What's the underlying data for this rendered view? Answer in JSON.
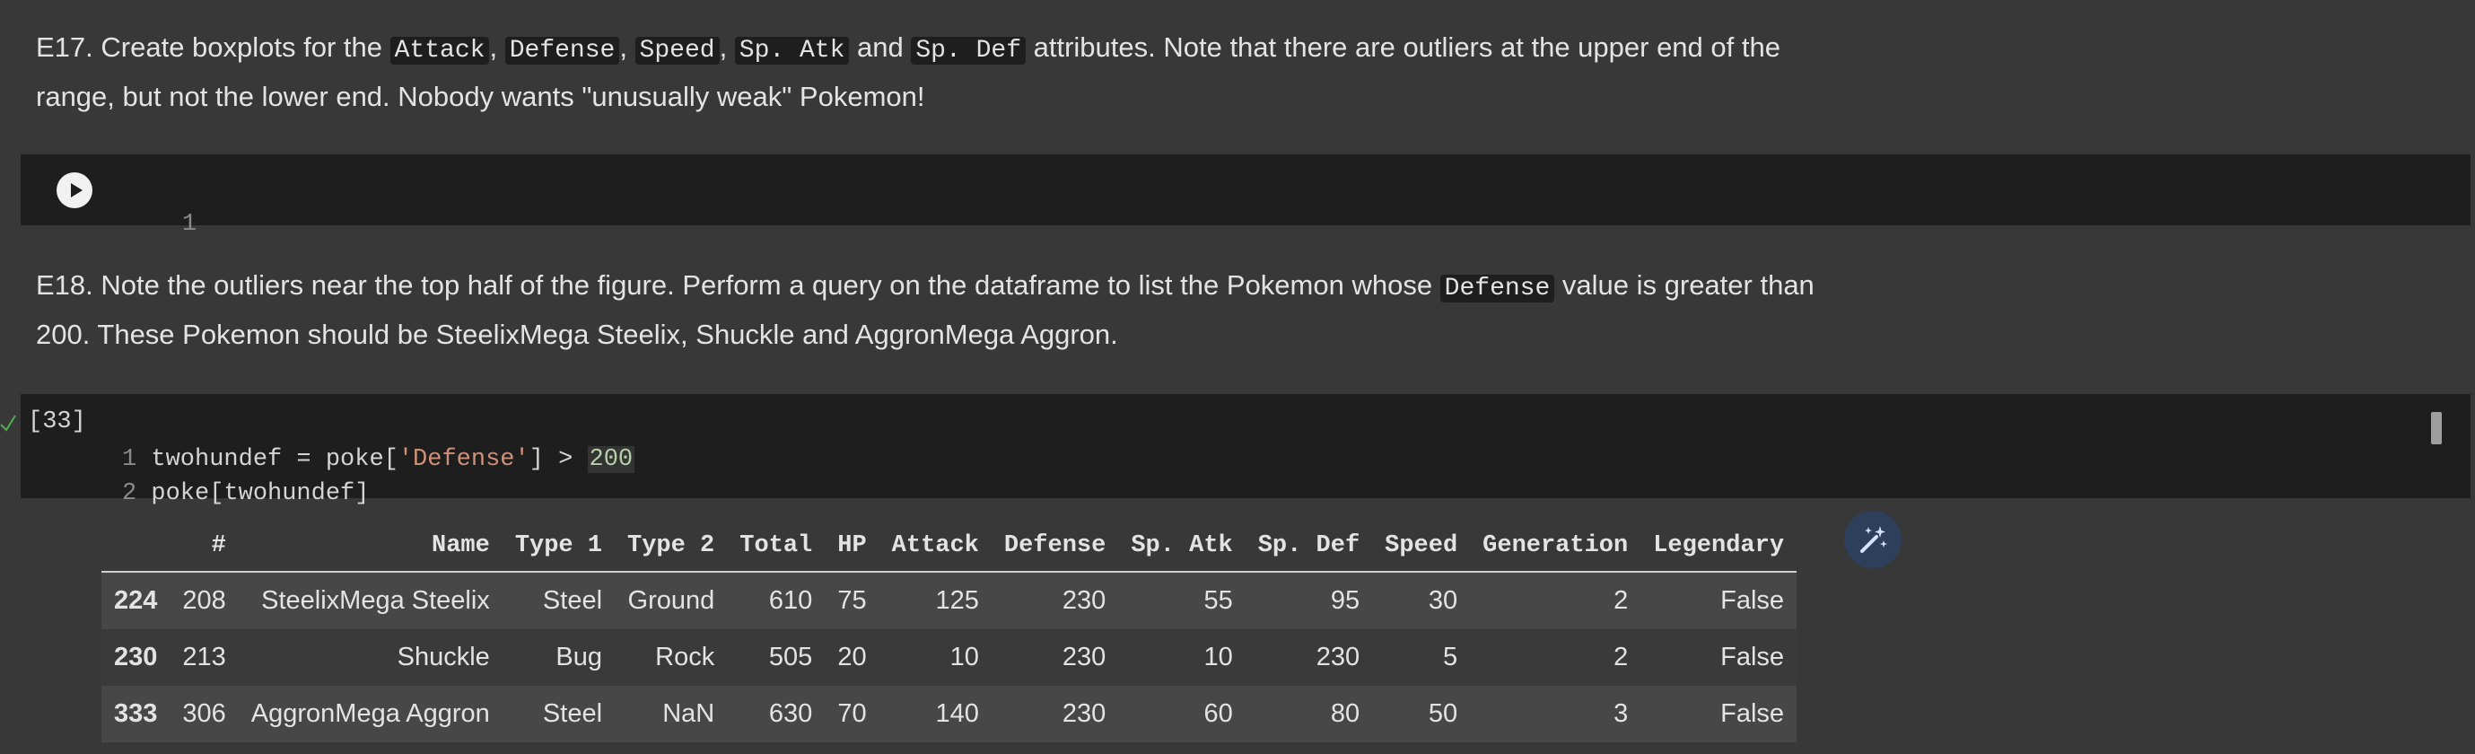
{
  "e17": {
    "prefix": "E17. Create boxplots for the ",
    "code1": "Attack",
    "sep1": ", ",
    "code2": "Defense",
    "sep2": ", ",
    "code3": "Speed",
    "sep3": ", ",
    "code4": "Sp. Atk",
    "sep4": " and ",
    "code5": "Sp. Def",
    "suffix": " attributes. Note that there are outliers at the upper end of the range, but not the lower end. Nobody wants \"unusually weak\" Pokemon!"
  },
  "empty_cell": {
    "line_number": "1"
  },
  "e18": {
    "prefix": "E18. Note the outliers near the top half of the figure. Perform a query on the dataframe to list the Pokemon whose ",
    "code1": "Defense",
    "suffix": " value is greater than 200. These Pokemon should be SteelixMega Steelix, Shuckle and AggronMega Aggron."
  },
  "code_cell": {
    "exec_count": "[33]",
    "lines": [
      {
        "num": "1",
        "a": "twohundef = poke[",
        "str": "'Defense'",
        "b": "] > ",
        "number": "200"
      },
      {
        "num": "2",
        "text": "poke[twohundef]"
      }
    ]
  },
  "dataframe": {
    "columns": [
      "",
      "#",
      "Name",
      "Type 1",
      "Type 2",
      "Total",
      "HP",
      "Attack",
      "Defense",
      "Sp. Atk",
      "Sp. Def",
      "Speed",
      "Generation",
      "Legendary"
    ],
    "rows": [
      [
        "224",
        "208",
        "SteelixMega Steelix",
        "Steel",
        "Ground",
        "610",
        "75",
        "125",
        "230",
        "55",
        "95",
        "30",
        "2",
        "False"
      ],
      [
        "230",
        "213",
        "Shuckle",
        "Bug",
        "Rock",
        "505",
        "20",
        "10",
        "230",
        "10",
        "230",
        "5",
        "2",
        "False"
      ],
      [
        "333",
        "306",
        "AggronMega Aggron",
        "Steel",
        "NaN",
        "630",
        "70",
        "140",
        "230",
        "60",
        "80",
        "50",
        "3",
        "False"
      ]
    ]
  },
  "icons": {
    "run": "play-icon",
    "done": "check-icon",
    "magic": "magic-wand-icon"
  },
  "colors": {
    "background": "#383838",
    "cell_bg": "#1e1e1e",
    "string": "#ce9178",
    "number": "#b5cea8",
    "magic_button": "#2e3f5c",
    "check": "#4caf50"
  }
}
